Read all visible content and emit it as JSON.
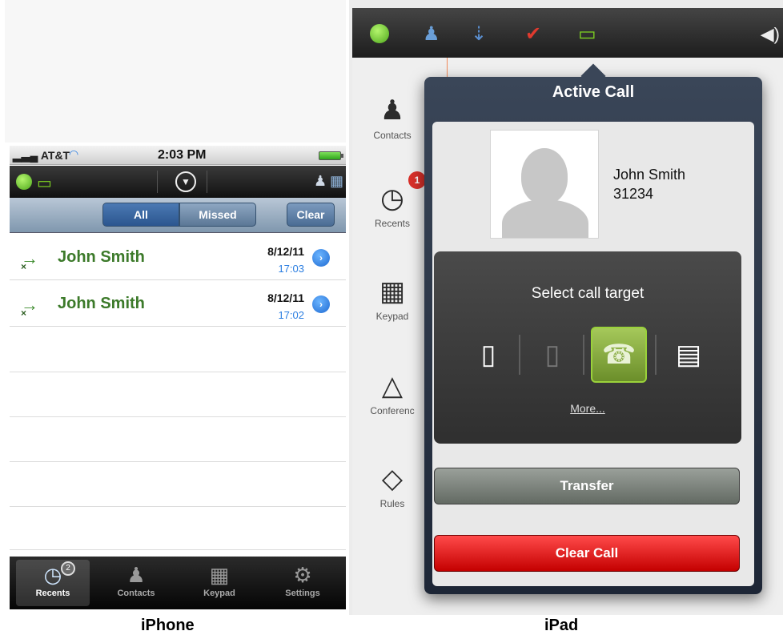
{
  "iphone": {
    "status_bar": {
      "carrier": "AT&T",
      "time": "2:03 PM"
    },
    "filter": {
      "all_label": "All",
      "missed_label": "Missed",
      "clear_label": "Clear"
    },
    "calls": [
      {
        "name": "John Smith",
        "date": "8/12/11",
        "time": "17:03"
      },
      {
        "name": "John Smith",
        "date": "8/12/11",
        "time": "17:02"
      }
    ],
    "tabbar": {
      "recents_label": "Recents",
      "recents_badge": "2",
      "contacts_label": "Contacts",
      "keypad_label": "Keypad",
      "settings_label": "Settings"
    },
    "caption": "iPhone"
  },
  "ipad": {
    "sidebar": {
      "contacts_label": "Contacts",
      "recents_label": "Recents",
      "recents_badge": "1",
      "keypad_label": "Keypad",
      "conference_label": "Conferenc",
      "rules_label": "Rules"
    },
    "popover": {
      "title": "Active Call",
      "contact_name": "John Smith",
      "contact_ext": "31234",
      "target_title": "Select call target",
      "more_label": "More...",
      "transfer_label": "Transfer",
      "clear_call_label": "Clear Call"
    },
    "caption": "iPad"
  },
  "icons": {
    "status": "green-dot-icon",
    "desk_phone": "desk-phone-icon",
    "menu": "chevron-down-icon",
    "person": "person-icon",
    "fax": "fax-icon",
    "tasks": "task-list-icon",
    "calendar": "calendar-icon",
    "speaker": "speaker-icon"
  },
  "colors": {
    "accent_green": "#7ed321",
    "name_green": "#3c7a2a",
    "link_blue": "#2a7de1",
    "clear_call_red": "#d40000",
    "badge_red": "#d9302a"
  }
}
